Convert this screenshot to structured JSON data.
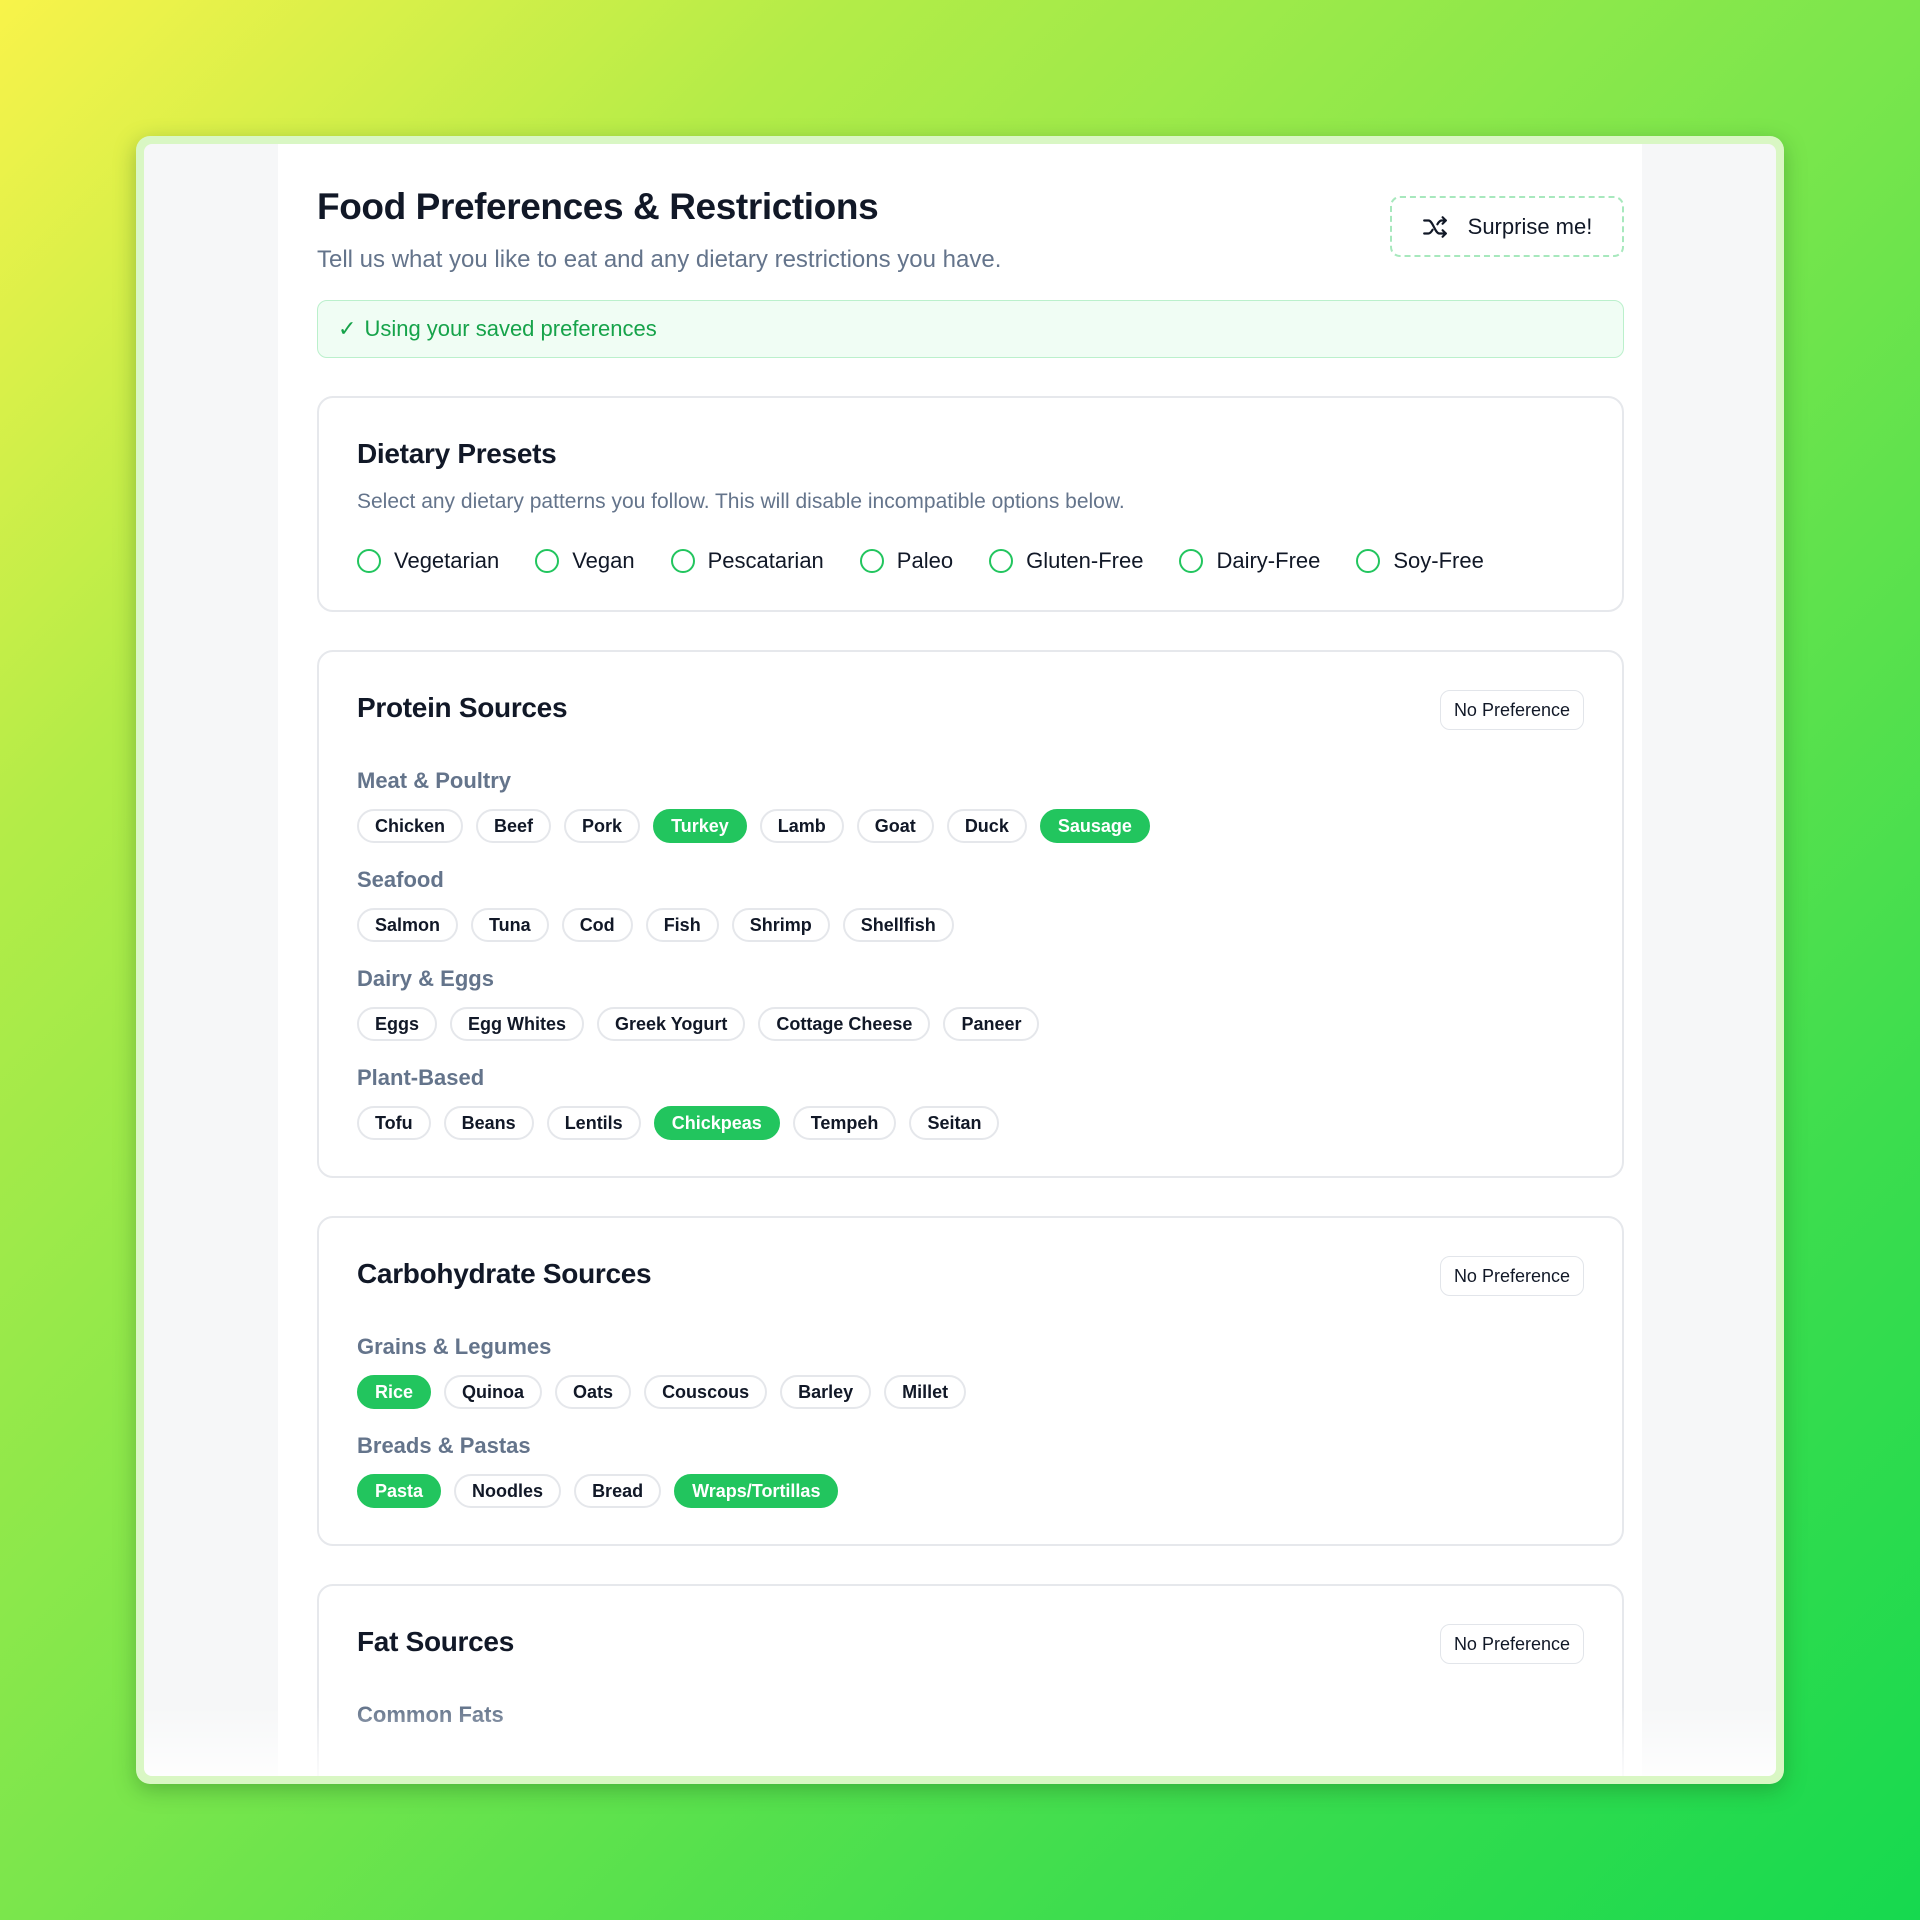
{
  "header": {
    "title": "Food Preferences & Restrictions",
    "subtitle": "Tell us what you like to eat and any dietary restrictions you have.",
    "surprise_label": "Surprise me!"
  },
  "banner": {
    "check": "✓",
    "text": "Using your saved preferences"
  },
  "presets": {
    "title": "Dietary Presets",
    "description": "Select any dietary patterns you follow. This will disable incompatible options below.",
    "options": [
      "Vegetarian",
      "Vegan",
      "Pescatarian",
      "Paleo",
      "Gluten-Free",
      "Dairy-Free",
      "Soy-Free"
    ]
  },
  "protein": {
    "title": "Protein Sources",
    "no_pref": "No Preference",
    "groups": [
      {
        "label": "Meat & Poultry",
        "items": [
          {
            "name": "Chicken",
            "selected": false
          },
          {
            "name": "Beef",
            "selected": false
          },
          {
            "name": "Pork",
            "selected": false
          },
          {
            "name": "Turkey",
            "selected": true
          },
          {
            "name": "Lamb",
            "selected": false
          },
          {
            "name": "Goat",
            "selected": false
          },
          {
            "name": "Duck",
            "selected": false
          },
          {
            "name": "Sausage",
            "selected": true
          }
        ]
      },
      {
        "label": "Seafood",
        "items": [
          {
            "name": "Salmon",
            "selected": false
          },
          {
            "name": "Tuna",
            "selected": false
          },
          {
            "name": "Cod",
            "selected": false
          },
          {
            "name": "Fish",
            "selected": false
          },
          {
            "name": "Shrimp",
            "selected": false
          },
          {
            "name": "Shellfish",
            "selected": false
          }
        ]
      },
      {
        "label": "Dairy & Eggs",
        "items": [
          {
            "name": "Eggs",
            "selected": false
          },
          {
            "name": "Egg Whites",
            "selected": false
          },
          {
            "name": "Greek Yogurt",
            "selected": false
          },
          {
            "name": "Cottage Cheese",
            "selected": false
          },
          {
            "name": "Paneer",
            "selected": false
          }
        ]
      },
      {
        "label": "Plant-Based",
        "items": [
          {
            "name": "Tofu",
            "selected": false
          },
          {
            "name": "Beans",
            "selected": false
          },
          {
            "name": "Lentils",
            "selected": false
          },
          {
            "name": "Chickpeas",
            "selected": true
          },
          {
            "name": "Tempeh",
            "selected": false
          },
          {
            "name": "Seitan",
            "selected": false
          }
        ]
      }
    ]
  },
  "carbs": {
    "title": "Carbohydrate Sources",
    "no_pref": "No Preference",
    "groups": [
      {
        "label": "Grains & Legumes",
        "items": [
          {
            "name": "Rice",
            "selected": true
          },
          {
            "name": "Quinoa",
            "selected": false
          },
          {
            "name": "Oats",
            "selected": false
          },
          {
            "name": "Couscous",
            "selected": false
          },
          {
            "name": "Barley",
            "selected": false
          },
          {
            "name": "Millet",
            "selected": false
          }
        ]
      },
      {
        "label": "Breads & Pastas",
        "items": [
          {
            "name": "Pasta",
            "selected": true
          },
          {
            "name": "Noodles",
            "selected": false
          },
          {
            "name": "Bread",
            "selected": false
          },
          {
            "name": "Wraps/Tortillas",
            "selected": true
          }
        ]
      }
    ]
  },
  "fat": {
    "title": "Fat Sources",
    "no_pref": "No Preference",
    "groups": [
      {
        "label": "Common Fats",
        "items": []
      }
    ]
  },
  "colors": {
    "accent": "#22c55e",
    "muted_text": "#64748b",
    "banner_bg": "#f0fdf4"
  }
}
